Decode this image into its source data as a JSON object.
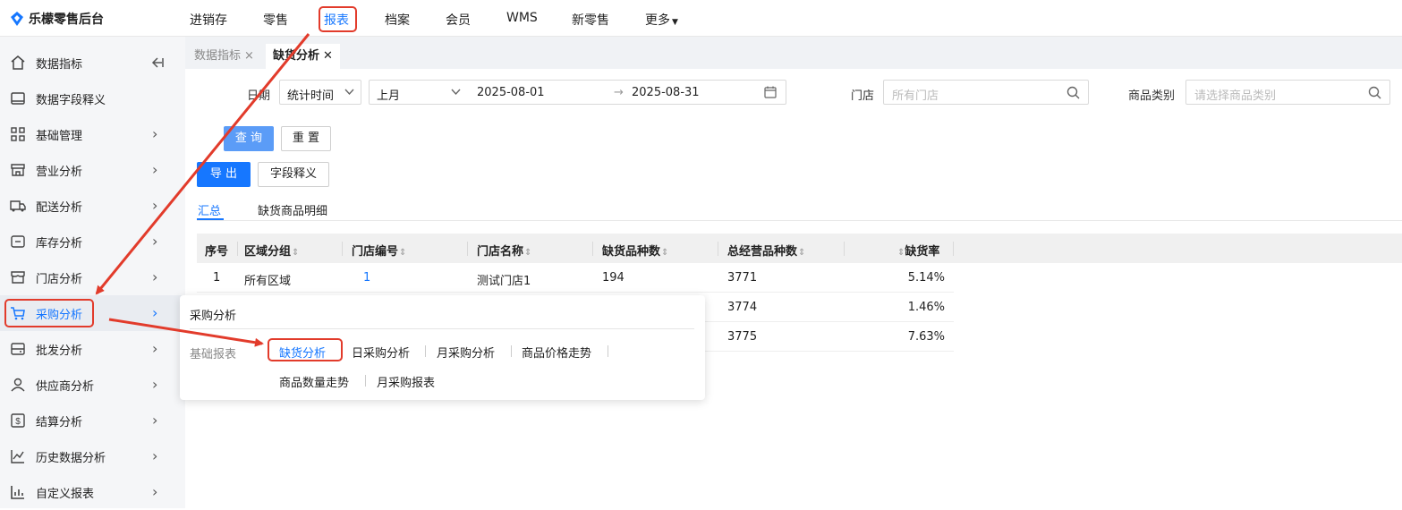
{
  "app": {
    "title": "乐檬零售后台"
  },
  "nav": {
    "items": [
      "进销存",
      "零售",
      "报表",
      "档案",
      "会员",
      "WMS",
      "新零售",
      "更多"
    ]
  },
  "sidebar": {
    "items": [
      {
        "label": "数据指标",
        "icon": "home-icon"
      },
      {
        "label": "数据字段释义",
        "icon": "monitor-icon"
      },
      {
        "label": "基础管理",
        "icon": "grid-icon"
      },
      {
        "label": "营业分析",
        "icon": "store-icon"
      },
      {
        "label": "配送分析",
        "icon": "truck-icon"
      },
      {
        "label": "库存分析",
        "icon": "inventory-icon"
      },
      {
        "label": "门店分析",
        "icon": "shop-icon"
      },
      {
        "label": "采购分析",
        "icon": "cart-icon"
      },
      {
        "label": "批发分析",
        "icon": "wholesale-icon"
      },
      {
        "label": "供应商分析",
        "icon": "user-icon"
      },
      {
        "label": "结算分析",
        "icon": "dollar-icon"
      },
      {
        "label": "历史数据分析",
        "icon": "chart-icon"
      },
      {
        "label": "自定义报表",
        "icon": "bar-chart-icon"
      }
    ]
  },
  "tabs": [
    {
      "label": "数据指标"
    },
    {
      "label": "缺货分析"
    }
  ],
  "filters": {
    "date_label": "日期",
    "date_type": "统计时间",
    "period": "上月",
    "start_date": "2025-08-01",
    "end_date": "2025-08-31",
    "store_label": "门店",
    "store_placeholder": "所有门店",
    "category_label": "商品类别",
    "category_placeholder": "请选择商品类别"
  },
  "buttons": {
    "query": "查 询",
    "reset": "重 置",
    "export": "导 出",
    "field_def": "字段释义"
  },
  "subtabs": [
    "汇总",
    "缺货商品明细"
  ],
  "table": {
    "headers": [
      "序号",
      "区域分组",
      "门店编号",
      "门店名称",
      "缺货品种数",
      "总经营品种数",
      "缺货率"
    ],
    "rows": [
      {
        "idx": "1",
        "region": "所有区域",
        "store_no": "1",
        "store_name": "测试门店1",
        "out_count": "194",
        "total": "3771",
        "rate": "5.14%"
      },
      {
        "total": "3774",
        "rate": "1.46%"
      },
      {
        "total": "3775",
        "rate": "7.63%"
      }
    ]
  },
  "popup": {
    "title": "采购分析",
    "category": "基础报表",
    "links": [
      "缺货分析",
      "日采购分析",
      "月采购分析",
      "商品价格走势",
      "商品数量走势",
      "月采购报表"
    ]
  },
  "colors": {
    "accent": "#1677ff",
    "annotation": "#e23b2b"
  }
}
